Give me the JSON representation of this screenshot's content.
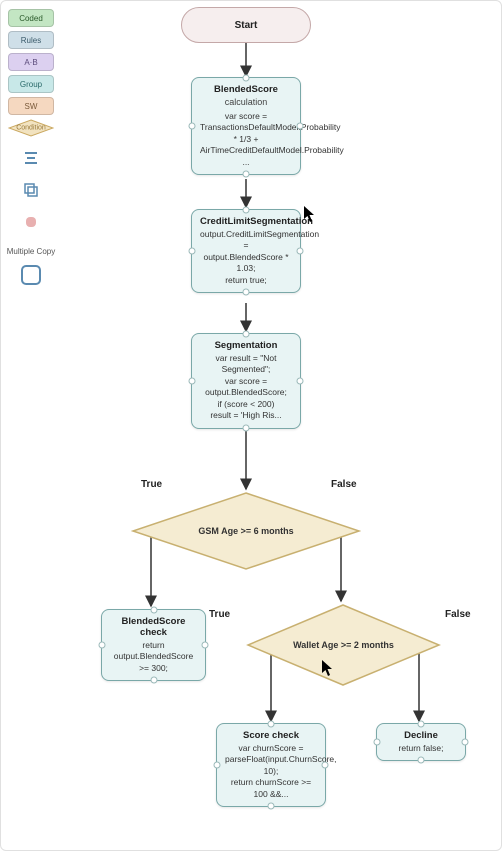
{
  "palette": {
    "coded": "Coded",
    "rules": "Rules",
    "ab": "A·B",
    "group": "Group",
    "sw": "SW",
    "condition": "Condition"
  },
  "multicopy_label": "Multiple\nCopy",
  "start": {
    "label": "Start"
  },
  "nodes": {
    "blended": {
      "title": "BlendedScore",
      "sub": "calculation",
      "body": "var score = TransactionsDefaultModel.Probability * 1/3 +\nAirTimeCreditDefaultModel.Probability ..."
    },
    "credit": {
      "title": "CreditLimitSegmentation",
      "body": "output.CreditLimitSegmentation =\noutput.BlendedScore * 1.03;\nreturn true;"
    },
    "segmentation": {
      "title": "Segmentation",
      "body": "var result = \"Not Segmented\";\nvar score = output.BlendedScore;\nif (score < 200)\nresult = 'High Ris..."
    },
    "blendedcheck": {
      "title": "BlendedScore check",
      "body": "return\noutput.BlendedScore >= 300;"
    },
    "scorecheck": {
      "title": "Score check",
      "body": "var churnScore = parseFloat(input.ChurnScore, 10);\nreturn churnScore >= 100 &&..."
    },
    "decline": {
      "title": "Decline",
      "body": "return false;"
    }
  },
  "conditions": {
    "gsm": "GSM Age >= 6 months",
    "wallet": "Wallet Age >= 2 months"
  },
  "edge_labels": {
    "true": "True",
    "false": "False"
  }
}
